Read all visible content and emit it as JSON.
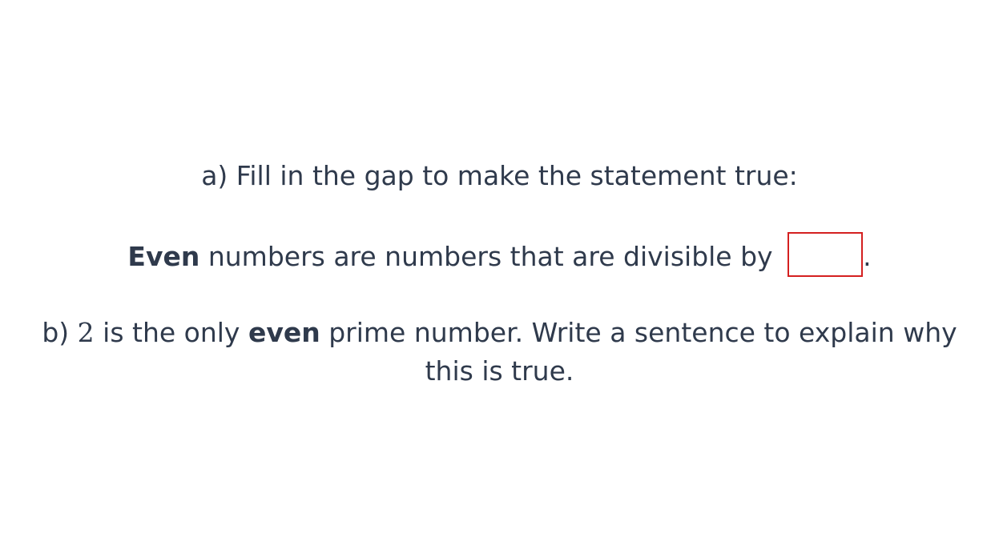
{
  "question_a": {
    "prompt": "a) Fill in the gap to make the statement true:",
    "statement": {
      "bold_word": "Even",
      "text": " numbers are numbers that are divisible by ",
      "gap_value": "",
      "end": "."
    },
    "colors": {
      "gap_border": "#d42020",
      "text": "#2f3a4c"
    }
  },
  "question_b": {
    "label": "b) ",
    "number": "2",
    "text_1": " is the only ",
    "bold_word": "even",
    "text_2": " prime number. Write a sentence to explain why",
    "line_2": "this is true."
  }
}
